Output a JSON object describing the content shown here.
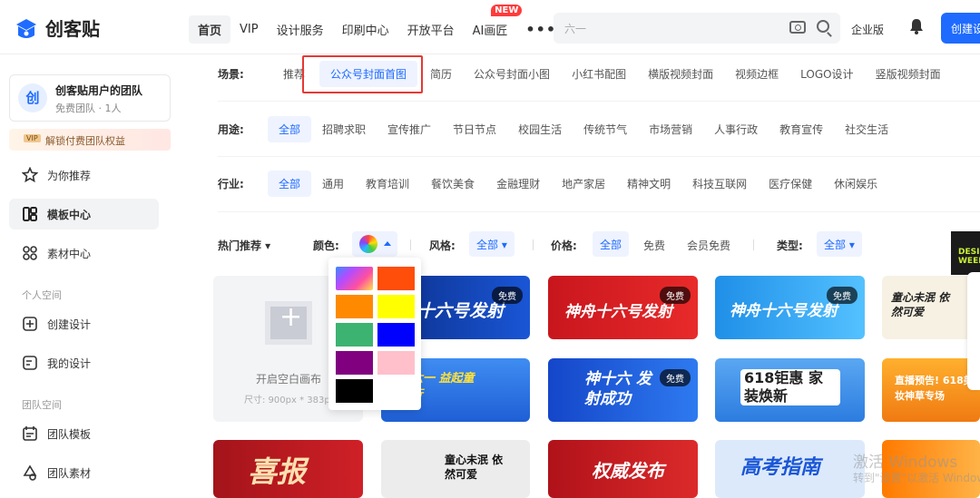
{
  "brand": {
    "name": "创客贴"
  },
  "nav": {
    "items": [
      "首页",
      "VIP",
      "设计服务",
      "印刷中心",
      "开放平台",
      "AI画匠"
    ],
    "new_badge": "NEW",
    "more": "•••"
  },
  "search": {
    "placeholder": "六一"
  },
  "header": {
    "enterprise": "企业版",
    "create_button": "创建设"
  },
  "sidebar": {
    "team_avatar": "创",
    "team_name": "创客贴用户的团队",
    "team_sub": "免费团队 · 1人",
    "vip_tag": "VIP",
    "unlock_text": "解锁付费团队权益",
    "items": [
      "为你推荐",
      "模板中心",
      "素材中心"
    ],
    "section_personal": "个人空间",
    "personal_items": [
      "创建设计",
      "我的设计"
    ],
    "section_team": "团队空间",
    "team_items": [
      "团队模板",
      "团队素材"
    ]
  },
  "filters": {
    "scene": {
      "label": "场景:",
      "options": [
        "推荐",
        "公众号封面首图",
        "简历",
        "公众号封面小图",
        "小红书配图",
        "横版视频封面",
        "视频边框",
        "LOGO设计",
        "竖版视频封面"
      ],
      "active": "公众号封面首图"
    },
    "usage": {
      "label": "用途:",
      "options": [
        "全部",
        "招聘求职",
        "宣传推广",
        "节日节点",
        "校园生活",
        "传统节气",
        "市场营销",
        "人事行政",
        "教育宣传",
        "社交生活"
      ],
      "active": "全部"
    },
    "industry": {
      "label": "行业:",
      "options": [
        "全部",
        "通用",
        "教育培训",
        "餐饮美食",
        "金融理财",
        "地产家居",
        "精神文明",
        "科技互联网",
        "医疗保健",
        "休闲娱乐"
      ],
      "active": "全部"
    }
  },
  "toolbar": {
    "hot": "热门推荐 ▾",
    "color_label": "颜色:",
    "style_label": "风格:",
    "style_value": "全部 ▾",
    "price_label": "价格:",
    "price_options": [
      "全部",
      "免费",
      "会员免费"
    ],
    "type_label": "类型:",
    "type_value": "全部 ▾"
  },
  "palette": {
    "colors": [
      "rainbow",
      "#ff4d0a",
      "#ff8a00",
      "#ffff00",
      "#3cb371",
      "#0000ff",
      "#800080",
      "#ffc0cb",
      "#000000"
    ]
  },
  "blank": {
    "title": "开启空白画布",
    "size": "尺寸: 900px * 383px"
  },
  "cards": [
    {
      "title": "十六号发射",
      "free": "免费",
      "bg": "#0d3fa8"
    },
    {
      "title": "神舟十六号发射",
      "free": "免费",
      "bg": "#d41a1a"
    },
    {
      "title": "神舟十六号发射",
      "free": "免费",
      "bg": "#2e8de8"
    },
    {
      "title": "童心未泯 依然可爱",
      "free": "",
      "bg": "#f7f2e6"
    },
    {
      "title": "六一 益起童行",
      "free": "",
      "bg": "#2a6fe0"
    },
    {
      "title": "神十六 发射成功",
      "free": "免费",
      "bg": "#1a4fd6"
    },
    {
      "title": "618钜惠 家装焕新",
      "free": "",
      "bg": "#3d8fe8"
    },
    {
      "title": "直播预告! 618美妆神草专场",
      "free": "",
      "bg": "#f5a623"
    },
    {
      "title": "喜报",
      "free": "",
      "bg": "#b71c1c"
    },
    {
      "title": "童心未泯 依然可爱",
      "free": "",
      "bg": "#eeeeee"
    },
    {
      "title": "权威发布",
      "free": "",
      "bg": "#c2181f"
    },
    {
      "title": "高考指南",
      "free": "",
      "bg": "#dbe9fb"
    },
    {
      "title": "",
      "free": "",
      "bg": "#ff6a00"
    }
  ],
  "overlay": {
    "watermark": "激活 Windows",
    "watermark_sub": "转到\"设置\"以激活 Windows",
    "desi": "DESI WEEK"
  }
}
